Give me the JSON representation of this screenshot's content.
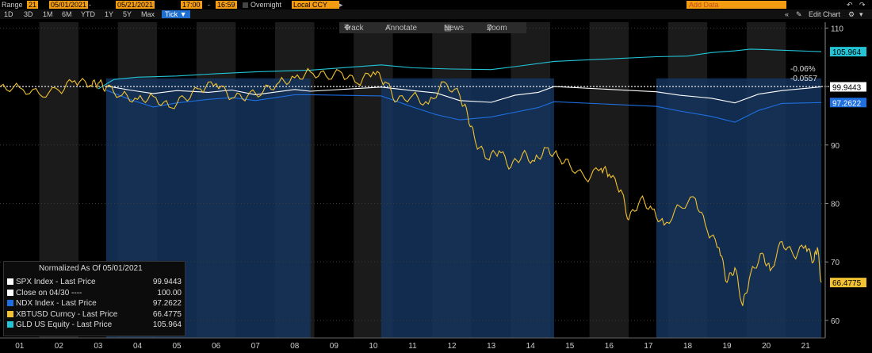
{
  "toolbar": {
    "range_label": "Range",
    "range_num": "21",
    "start_date": "05/01/2021",
    "end_date": "05/21/2021",
    "start_time": "17:00",
    "end_time": "16:59",
    "overnight_label": "Overnight",
    "currency": "Local CCY",
    "add_data_placeholder": "Add Data",
    "edit_chart_label": "Edit Chart",
    "periods": [
      "1D",
      "3D",
      "1M",
      "6M",
      "YTD",
      "1Y",
      "5Y",
      "Max"
    ],
    "tick_label": "Tick ▼"
  },
  "chart_tools": {
    "track": "Track",
    "annotate": "Annotate",
    "news": "News",
    "zoom": "Zoom"
  },
  "annotations": {
    "pct_change": "-0.06%",
    "abs_change": "-0.0557"
  },
  "legend": {
    "title": "Normalized As Of 05/01/2021",
    "items": [
      {
        "label": "SPX Index - Last Price",
        "value": "99.9443",
        "color": "#ffffff"
      },
      {
        "label": "Close on 04/30 ----",
        "value": "100.00",
        "color": "#ffffff"
      },
      {
        "label": "NDX Index - Last Price",
        "value": "97.2622",
        "color": "#1e6fe0"
      },
      {
        "label": "XBTUSD Curncy - Last Price",
        "value": "66.4775",
        "color": "#f2c230"
      },
      {
        "label": "GLD US Equity - Last Price",
        "value": "105.964",
        "color": "#22c4d6"
      }
    ]
  },
  "value_tags": [
    {
      "value": "105.964",
      "bg": "#22c4d6",
      "fg": "#000",
      "y": 105.964
    },
    {
      "value": "99.9443",
      "bg": "#ffffff",
      "fg": "#000",
      "y": 99.9443
    },
    {
      "value": "97.2622",
      "bg": "#1e6fe0",
      "fg": "#fff",
      "y": 97.2622
    },
    {
      "value": "66.4775",
      "bg": "#f2c230",
      "fg": "#000",
      "y": 66.4775
    }
  ],
  "chart_data": {
    "type": "line",
    "ylim": [
      57,
      111
    ],
    "yticks": [
      60,
      70,
      80,
      90,
      100,
      110
    ],
    "xlim": [
      0.5,
      21.5
    ],
    "x_tick_labels": [
      "01",
      "02",
      "03",
      "04",
      "05",
      "06",
      "07",
      "08",
      "09",
      "10",
      "11",
      "12",
      "13",
      "14",
      "15",
      "16",
      "17",
      "18",
      "19",
      "20",
      "21"
    ],
    "reference_line": 100,
    "trading_sessions": [
      [
        3.2,
        8.4
      ],
      [
        10.2,
        14.6
      ],
      [
        17.2,
        21.4
      ]
    ],
    "series": [
      {
        "name": "GLD US Equity - Last Price",
        "color": "#22c4d6",
        "points": [
          [
            3,
            99.6
          ],
          [
            3.4,
            101.2
          ],
          [
            4,
            101.6
          ],
          [
            5,
            101.8
          ],
          [
            6,
            102.2
          ],
          [
            7,
            102.5
          ],
          [
            8.4,
            102.8
          ],
          [
            10.2,
            103.7
          ],
          [
            11,
            103.2
          ],
          [
            12,
            103.0
          ],
          [
            13,
            102.9
          ],
          [
            13.6,
            103.4
          ],
          [
            14.6,
            104.3
          ],
          [
            17.2,
            105.1
          ],
          [
            18,
            105.2
          ],
          [
            18.6,
            105.8
          ],
          [
            19.2,
            106.1
          ],
          [
            19.6,
            106.4
          ],
          [
            20,
            106.3
          ],
          [
            21.4,
            105.96
          ]
        ]
      },
      {
        "name": "SPX Index - Last Price",
        "color": "#ffffff",
        "points": [
          [
            3.2,
            100.1
          ],
          [
            3.8,
            99.4
          ],
          [
            4.4,
            98.8
          ],
          [
            5,
            99.3
          ],
          [
            5.8,
            99.0
          ],
          [
            6.4,
            99.4
          ],
          [
            7,
            98.6
          ],
          [
            8,
            99.5
          ],
          [
            8.4,
            99.2
          ],
          [
            10.2,
            99.9
          ],
          [
            11,
            99.3
          ],
          [
            11.6,
            98.9
          ],
          [
            12.2,
            97.6
          ],
          [
            13,
            97.3
          ],
          [
            13.6,
            98.5
          ],
          [
            14.2,
            99.0
          ],
          [
            14.6,
            100.0
          ],
          [
            17.2,
            99.1
          ],
          [
            17.8,
            98.5
          ],
          [
            18.6,
            98.0
          ],
          [
            19.2,
            97.2
          ],
          [
            19.8,
            98.7
          ],
          [
            20.4,
            99.3
          ],
          [
            21.4,
            99.94
          ]
        ]
      },
      {
        "name": "NDX Index - Last Price",
        "color": "#1e6fe0",
        "points": [
          [
            3.2,
            99.4
          ],
          [
            3.8,
            97.8
          ],
          [
            4.4,
            96.5
          ],
          [
            5,
            97.2
          ],
          [
            5.8,
            97.8
          ],
          [
            6.4,
            98.1
          ],
          [
            7,
            97.6
          ],
          [
            8,
            98.6
          ],
          [
            8.4,
            98.6
          ],
          [
            10.2,
            98.4
          ],
          [
            11,
            96.5
          ],
          [
            11.6,
            95.2
          ],
          [
            12.2,
            94.3
          ],
          [
            13,
            94.8
          ],
          [
            13.6,
            95.6
          ],
          [
            14.2,
            96.4
          ],
          [
            14.6,
            97.4
          ],
          [
            17.2,
            96.6
          ],
          [
            17.8,
            95.8
          ],
          [
            18.6,
            94.9
          ],
          [
            19.2,
            93.9
          ],
          [
            19.8,
            95.9
          ],
          [
            20.4,
            97.1
          ],
          [
            21.4,
            97.26
          ]
        ]
      },
      {
        "name": "XBTUSD Curncy - Last Price",
        "color": "#f2c230",
        "points": [
          [
            0.5,
            100.0
          ],
          [
            1.0,
            99.8
          ],
          [
            1.5,
            98.7
          ],
          [
            2.0,
            99.3
          ],
          [
            2.4,
            101.0
          ],
          [
            2.8,
            100.2
          ],
          [
            3.0,
            100.6
          ],
          [
            3.2,
            99.8
          ],
          [
            3.6,
            98.5
          ],
          [
            4.0,
            97.8
          ],
          [
            4.4,
            98.3
          ],
          [
            4.8,
            96.5
          ],
          [
            5.2,
            98.0
          ],
          [
            5.6,
            99.6
          ],
          [
            6.0,
            100.5
          ],
          [
            6.4,
            98.0
          ],
          [
            6.8,
            98.4
          ],
          [
            7.2,
            99.2
          ],
          [
            7.6,
            100.7
          ],
          [
            8.0,
            101.5
          ],
          [
            8.4,
            102.5
          ],
          [
            8.8,
            101.8
          ],
          [
            9.2,
            102.3
          ],
          [
            9.6,
            100.5
          ],
          [
            10.0,
            102.5
          ],
          [
            10.3,
            100.8
          ],
          [
            10.6,
            97.5
          ],
          [
            11.0,
            98.5
          ],
          [
            11.4,
            97.0
          ],
          [
            11.8,
            100.8
          ],
          [
            12.2,
            98.5
          ],
          [
            12.4,
            95.2
          ],
          [
            12.6,
            90.5
          ],
          [
            12.9,
            87.6
          ],
          [
            13.2,
            89.0
          ],
          [
            13.5,
            86.2
          ],
          [
            13.8,
            88.5
          ],
          [
            14.1,
            87.2
          ],
          [
            14.4,
            89.5
          ],
          [
            14.7,
            88.0
          ],
          [
            15.0,
            86.6
          ],
          [
            15.4,
            84.2
          ],
          [
            15.8,
            86.0
          ],
          [
            16.0,
            85.0
          ],
          [
            16.3,
            82.3
          ],
          [
            16.5,
            77.2
          ],
          [
            16.8,
            80.8
          ],
          [
            17.1,
            79.0
          ],
          [
            17.4,
            76.3
          ],
          [
            17.8,
            79.5
          ],
          [
            18.2,
            80.8
          ],
          [
            18.5,
            75.3
          ],
          [
            18.8,
            72.4
          ],
          [
            19.0,
            66.5
          ],
          [
            19.2,
            69.0
          ],
          [
            19.4,
            62.5
          ],
          [
            19.6,
            68.0
          ],
          [
            19.9,
            71.5
          ],
          [
            20.1,
            68.5
          ],
          [
            20.4,
            73.5
          ],
          [
            20.7,
            71.0
          ],
          [
            21.0,
            72.8
          ],
          [
            21.2,
            70.0
          ],
          [
            21.3,
            72.5
          ],
          [
            21.4,
            66.48
          ]
        ]
      }
    ]
  }
}
